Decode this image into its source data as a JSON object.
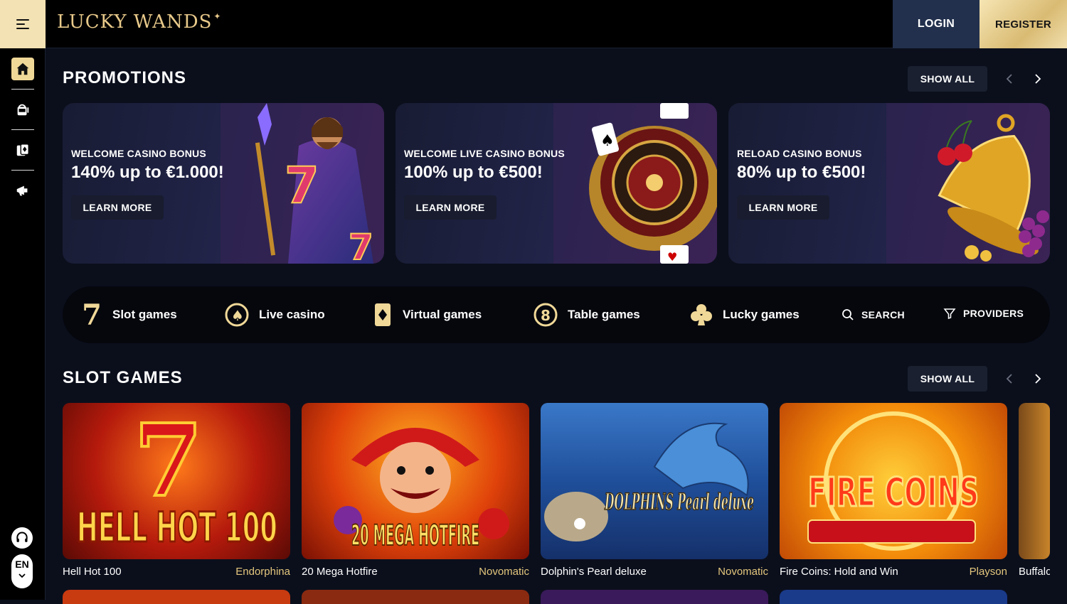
{
  "brand": {
    "logo_text": "LUCKY WANDS",
    "accent": "#f0d898",
    "gold": "#e4c77d"
  },
  "header": {
    "login_label": "LOGIN",
    "register_label": "REGISTER"
  },
  "rail": {
    "items": [
      {
        "icon": "home-icon",
        "active": true
      },
      {
        "icon": "slot-machine-icon",
        "active": false
      },
      {
        "icon": "cards-icon",
        "active": false
      },
      {
        "icon": "megaphone-icon",
        "active": false
      }
    ],
    "support_icon": "headset-icon",
    "language": "EN"
  },
  "promotions": {
    "title": "PROMOTIONS",
    "show_all_label": "SHOW ALL",
    "cards": [
      {
        "kicker": "WELCOME CASINO BONUS",
        "headline": "140% up to €1.000!",
        "button": "LEARN MORE",
        "art": "wizard"
      },
      {
        "kicker": "WELCOME LIVE CASINO BONUS",
        "headline": "100% up to €500!",
        "button": "LEARN MORE",
        "art": "roulette"
      },
      {
        "kicker": "RELOAD CASINO BONUS",
        "headline": "80% up to €500!",
        "button": "LEARN MORE",
        "art": "bell"
      }
    ]
  },
  "categories": [
    {
      "label": "Slot games",
      "icon": "seven-icon"
    },
    {
      "label": "Live casino",
      "icon": "spade-chip-icon"
    },
    {
      "label": "Virtual games",
      "icon": "diamond-card-icon"
    },
    {
      "label": "Table games",
      "icon": "eight-ball-icon"
    },
    {
      "label": "Lucky games",
      "icon": "club-icon"
    },
    {
      "label": "SEARCH",
      "icon": "search-icon"
    },
    {
      "label": "PROVIDERS",
      "icon": "filter-icon"
    }
  ],
  "slot_games": {
    "title": "SLOT GAMES",
    "show_all_label": "SHOW ALL",
    "games": [
      {
        "name": "Hell Hot 100",
        "provider": "Endorphina",
        "tile_text": "HELL HOT 100"
      },
      {
        "name": "20 Mega Hotfire",
        "provider": "Novomatic",
        "tile_text": "20 MEGA HOTFIRE"
      },
      {
        "name": "Dolphin's Pearl deluxe",
        "provider": "Novomatic",
        "tile_text": "DOLPHINS Pearl deluxe"
      },
      {
        "name": "Fire Coins: Hold and Win",
        "provider": "Playson",
        "tile_text": "FIRE COINS"
      },
      {
        "name": "Buffalo",
        "provider": "",
        "tile_text": ""
      }
    ]
  }
}
